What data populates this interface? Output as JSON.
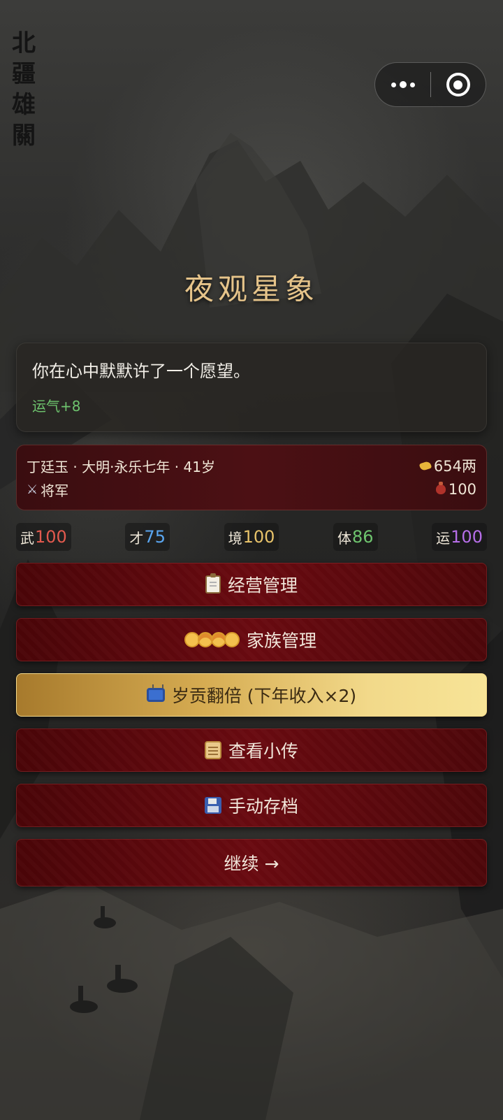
{
  "calligraphy": "北疆雄關",
  "title": "夜观星象",
  "event": {
    "text": "你在心中默默许了一个愿望。",
    "effect": "运气+8",
    "effect_color": "#6ec46e"
  },
  "status": {
    "info": "丁廷玉 · 大明·永乐七年 · 41岁",
    "silver": "654两",
    "rank": "将军",
    "pouch": "100",
    "icons": [
      "gold-ingot-icon",
      "crossed-swords-icon",
      "money-pouch-icon"
    ]
  },
  "attributes": [
    {
      "label": "武",
      "value": "100",
      "color": "#e35a4e"
    },
    {
      "label": "才",
      "value": "75",
      "color": "#5aa6f0"
    },
    {
      "label": "境",
      "value": "100",
      "color": "#e8c36a"
    },
    {
      "label": "体",
      "value": "86",
      "color": "#6ec46e"
    },
    {
      "label": "运",
      "value": "100",
      "color": "#b66ee8"
    }
  ],
  "buttons": {
    "manage": "经营管理",
    "family": "家族管理",
    "double": "岁贡翻倍 (下年收入×2)",
    "biography": "查看小传",
    "save": "手动存档",
    "continue": "继续 →"
  },
  "colors": {
    "title": "#e6c48a",
    "button_red": "#6a0a10",
    "button_gold": "#f2d98a"
  }
}
